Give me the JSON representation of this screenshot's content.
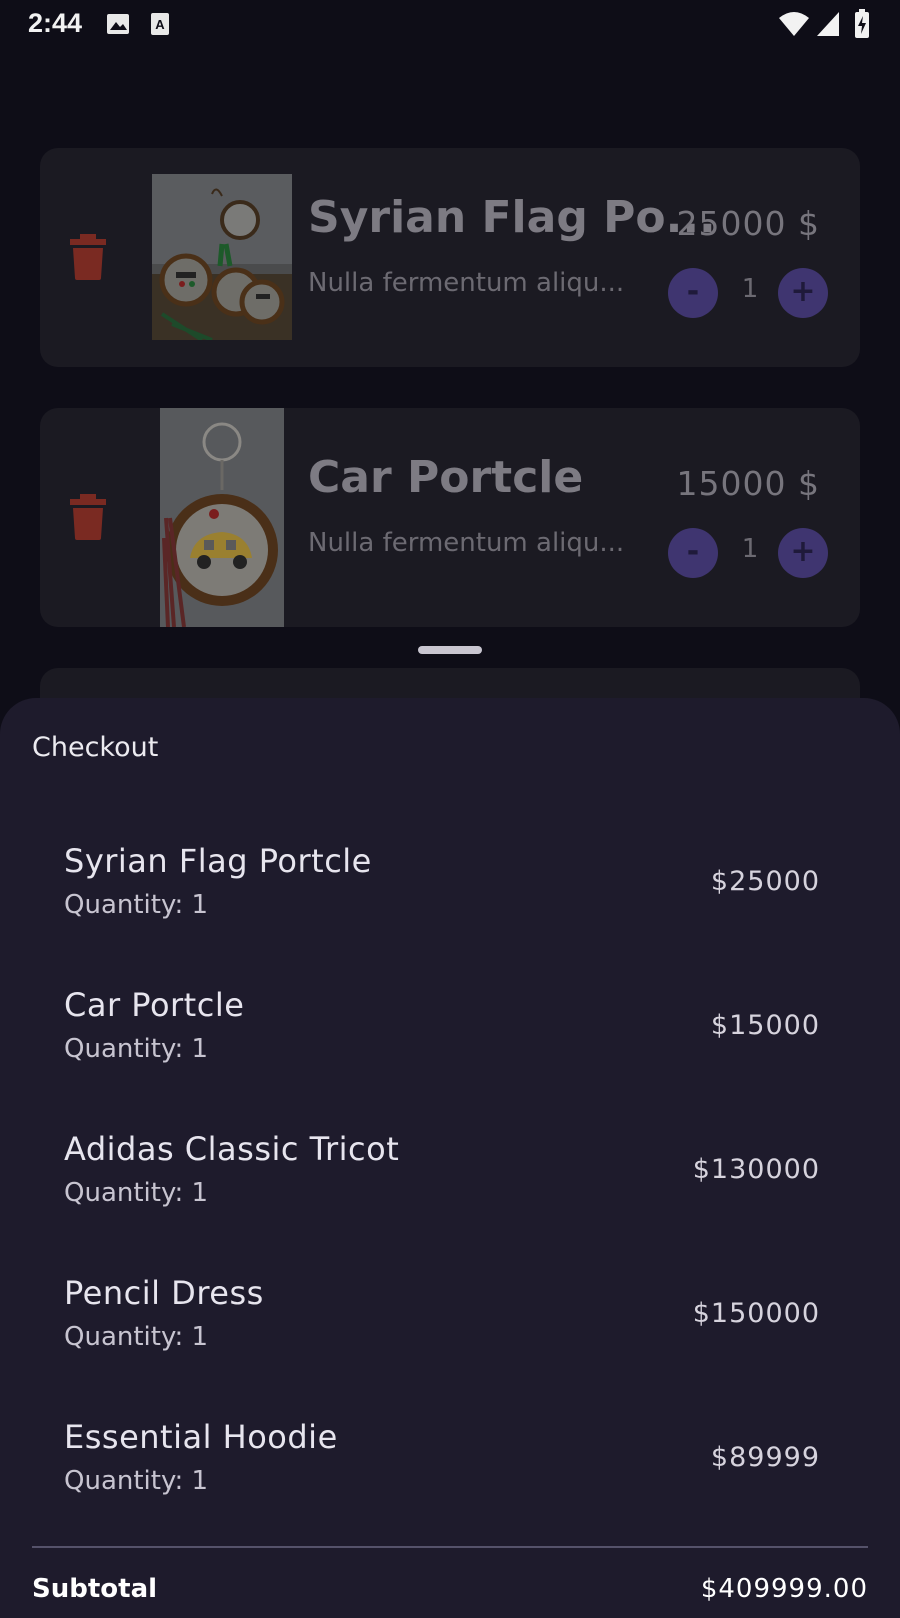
{
  "status_bar": {
    "time": "2:44"
  },
  "cart": {
    "items": [
      {
        "title": "Syrian Flag Po...",
        "description": "Nulla fermentum aliqu...",
        "price": "25000 $",
        "quantity": "1",
        "decrement": "-",
        "increment": "+"
      },
      {
        "title": "Car Portcle",
        "description": "Nulla fermentum aliqu...",
        "price": "15000 $",
        "quantity": "1",
        "decrement": "-",
        "increment": "+"
      }
    ]
  },
  "checkout": {
    "title": "Checkout",
    "items": [
      {
        "name": "Syrian Flag Portcle",
        "quantity": "Quantity: 1",
        "price": "$25000"
      },
      {
        "name": "Car Portcle",
        "quantity": "Quantity: 1",
        "price": "$15000"
      },
      {
        "name": "Adidas Classic Tricot",
        "quantity": "Quantity: 1",
        "price": "$130000"
      },
      {
        "name": "Pencil Dress",
        "quantity": "Quantity: 1",
        "price": "$150000"
      },
      {
        "name": "Essential Hoodie",
        "quantity": "Quantity: 1",
        "price": "$89999"
      }
    ],
    "subtotal_label": "Subtotal",
    "subtotal_value": "$409999.00"
  },
  "colors": {
    "background": "#0e0d17",
    "card": "#1b1a22",
    "sheet": "#1e1b2c",
    "accent": "#3f3570",
    "trash": "#7a2a22"
  }
}
